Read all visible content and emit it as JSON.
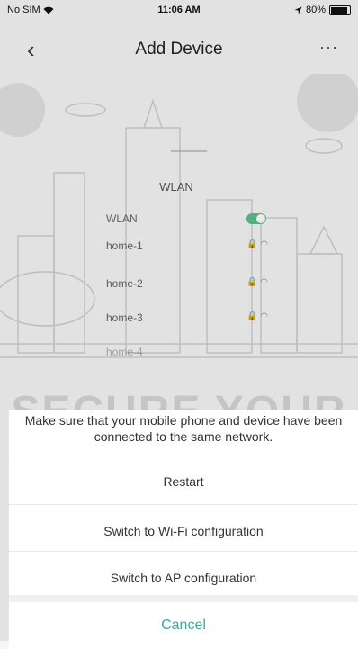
{
  "status_bar": {
    "carrier": "No SIM",
    "time": "11:06 AM",
    "battery_percent": "80%",
    "battery_level": 0.8
  },
  "nav": {
    "back_icon": "chevron-left-icon",
    "title": "Add Device",
    "more_icon": "more-icon",
    "more": "···"
  },
  "illustration": {
    "header": "WLAN",
    "networks": [
      {
        "name": "WLAN"
      },
      {
        "name": "home-1"
      },
      {
        "name": "home-2"
      },
      {
        "name": "home-3"
      },
      {
        "name": "home-4"
      }
    ]
  },
  "watermark": "SECURE YOUR",
  "sheet": {
    "message": "Make sure that your mobile phone and device have been connected to the same network.",
    "options": [
      "Restart",
      "Switch to Wi-Fi configuration",
      "Switch to AP configuration"
    ],
    "cancel": "Cancel"
  },
  "colors": {
    "accent": "#3aa8a8",
    "toggle": "#5cbf8a"
  }
}
